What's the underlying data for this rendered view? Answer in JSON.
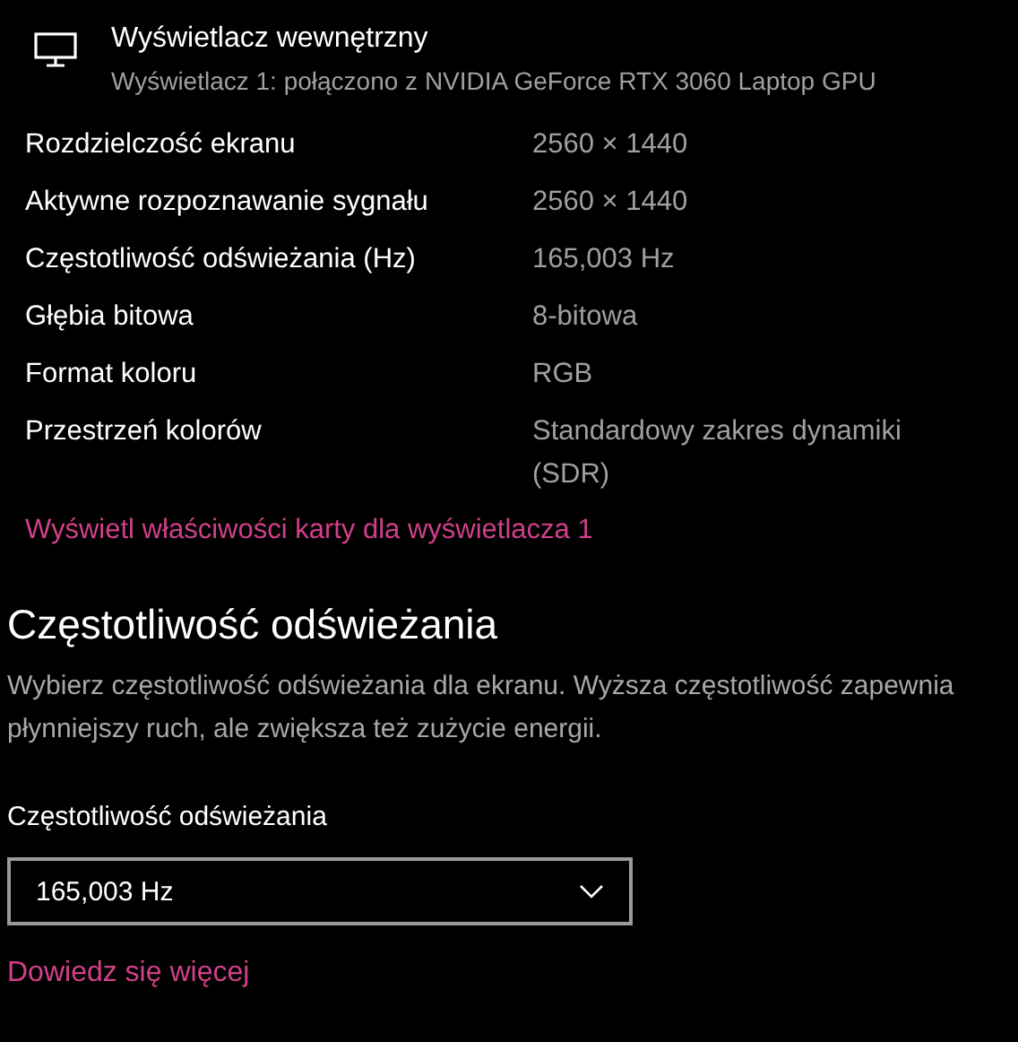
{
  "display": {
    "title": "Wyświetlacz wewnętrzny",
    "subtitle": "Wyświetlacz 1: połączono z NVIDIA GeForce RTX 3060 Laptop GPU"
  },
  "properties": [
    {
      "label": "Rozdzielczość ekranu",
      "value": "2560 × 1440"
    },
    {
      "label": "Aktywne rozpoznawanie sygnału",
      "value": "2560 × 1440"
    },
    {
      "label": "Częstotliwość odświeżania (Hz)",
      "value": "165,003 Hz"
    },
    {
      "label": "Głębia bitowa",
      "value": "8-bitowa"
    },
    {
      "label": "Format koloru",
      "value": "RGB"
    },
    {
      "label": "Przestrzeń kolorów",
      "value": "Standardowy zakres dynamiki (SDR)"
    }
  ],
  "adapter_link": "Wyświetl właściwości karty dla wyświetlacza 1",
  "refresh_section": {
    "heading": "Częstotliwość odświeżania",
    "description": "Wybierz częstotliwość odświeżania dla ekranu. Wyższa częstotliwość zapewnia płynniejszy ruch, ale zwiększa też zużycie energii.",
    "field_label": "Częstotliwość odświeżania",
    "dropdown_value": "165,003 Hz"
  },
  "learn_more_link": "Dowiedz się więcej"
}
